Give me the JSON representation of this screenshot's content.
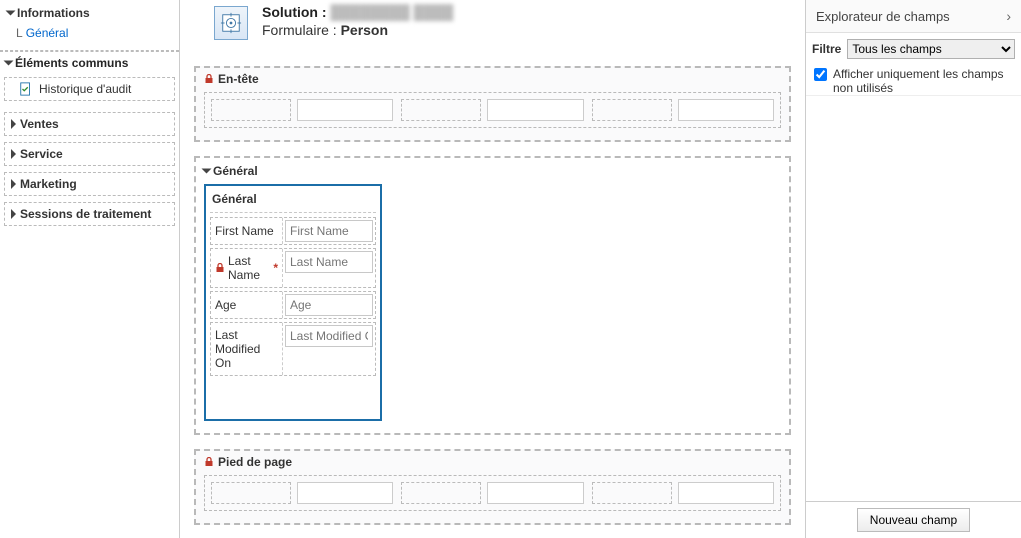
{
  "sidebar": {
    "infoTitle": "Informations",
    "generalLink": "Général",
    "commonTitle": "Éléments communs",
    "auditItem": "Historique d'audit",
    "salesTitle": "Ventes",
    "serviceTitle": "Service",
    "marketingTitle": "Marketing",
    "sessionsTitle": "Sessions de traitement"
  },
  "header": {
    "solutionLabel": "Solution :",
    "solutionName": "████████ ████",
    "formLabel": "Formulaire :",
    "formName": "Person"
  },
  "sections": {
    "headerTitle": "En-tête",
    "generalTab": "Général",
    "generalSub": "Général",
    "footerTitle": "Pied de page"
  },
  "fields": {
    "firstName": {
      "label": "First Name",
      "placeholder": "First Name",
      "locked": false,
      "required": false
    },
    "lastName": {
      "label": "Last Name",
      "placeholder": "Last Name",
      "locked": true,
      "required": true
    },
    "age": {
      "label": "Age",
      "placeholder": "Age",
      "locked": false,
      "required": false
    },
    "lastModified": {
      "label": "Last Modified On",
      "placeholder": "Last Modified O",
      "locked": false,
      "required": false
    }
  },
  "right": {
    "title": "Explorateur de champs",
    "filterLabel": "Filtre",
    "filterValue": "Tous les champs",
    "unusedOnly": "Afficher uniquement les champs non utilisés",
    "newField": "Nouveau champ"
  }
}
